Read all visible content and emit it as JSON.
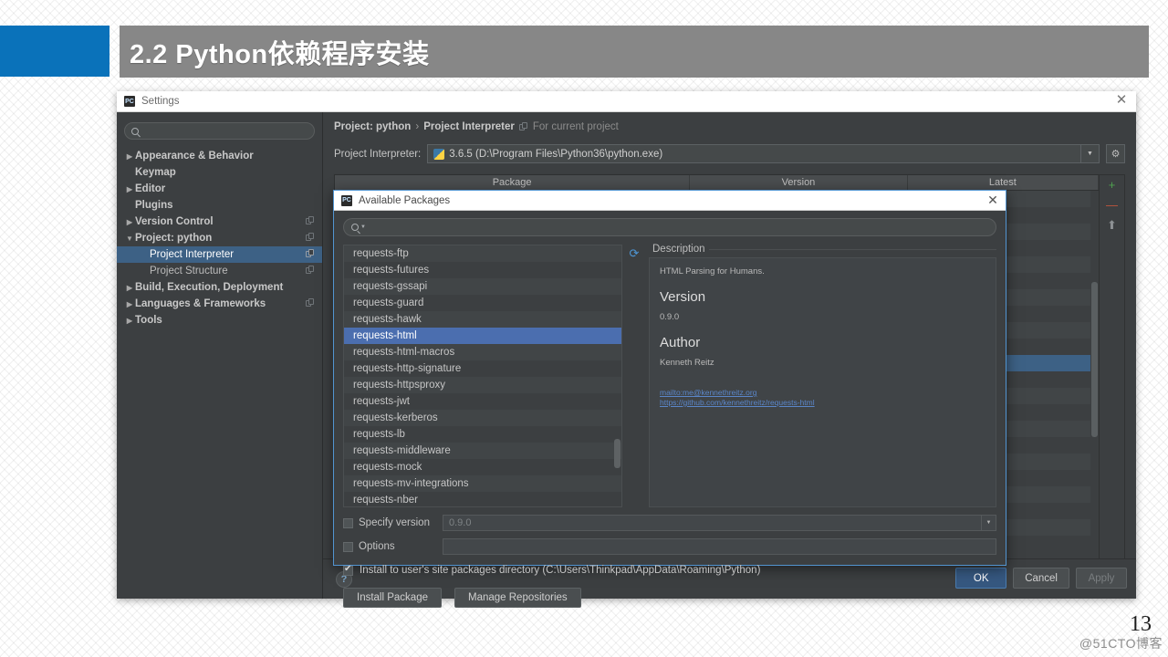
{
  "slide": {
    "title": "2.2 Python依赖程序安装",
    "number": "13",
    "watermark": "@51CTO博客",
    "accent_blue": "#0a72ba",
    "title_bar_gray": "#878787"
  },
  "settings_window": {
    "title": "Settings",
    "close_label": "✕",
    "search_placeholder": "",
    "tree": [
      {
        "label": "Appearance & Behavior",
        "arrow": "▶",
        "indent": 0,
        "bold": true,
        "badge": false,
        "selected": false
      },
      {
        "label": "Keymap",
        "arrow": "",
        "indent": 1,
        "bold": true,
        "badge": false,
        "selected": false
      },
      {
        "label": "Editor",
        "arrow": "▶",
        "indent": 0,
        "bold": true,
        "badge": false,
        "selected": false
      },
      {
        "label": "Plugins",
        "arrow": "",
        "indent": 1,
        "bold": true,
        "badge": false,
        "selected": false
      },
      {
        "label": "Version Control",
        "arrow": "▶",
        "indent": 0,
        "bold": true,
        "badge": true,
        "selected": false
      },
      {
        "label": "Project: python",
        "arrow": "▼",
        "indent": 0,
        "bold": true,
        "badge": true,
        "selected": false
      },
      {
        "label": "Project Interpreter",
        "arrow": "",
        "indent": 2,
        "bold": false,
        "badge": true,
        "selected": true
      },
      {
        "label": "Project Structure",
        "arrow": "",
        "indent": 2,
        "bold": false,
        "badge": true,
        "selected": false
      },
      {
        "label": "Build, Execution, Deployment",
        "arrow": "▶",
        "indent": 0,
        "bold": true,
        "badge": false,
        "selected": false
      },
      {
        "label": "Languages & Frameworks",
        "arrow": "▶",
        "indent": 0,
        "bold": true,
        "badge": true,
        "selected": false
      },
      {
        "label": "Tools",
        "arrow": "▶",
        "indent": 0,
        "bold": true,
        "badge": false,
        "selected": false
      }
    ],
    "breadcrumb": {
      "root": "Project: python",
      "separator": "›",
      "leaf": "Project Interpreter",
      "scope": "For current project"
    },
    "interpreter": {
      "label": "Project Interpreter:",
      "value": "3.6.5 (D:\\Program Files\\Python36\\python.exe)",
      "caret": "▼",
      "gear": "⚙"
    },
    "package_table": {
      "columns": [
        "Package",
        "Version",
        "Latest"
      ],
      "side_actions": [
        {
          "name": "add",
          "glyph": "+",
          "color": "#4fa14f"
        },
        {
          "name": "remove",
          "glyph": "—",
          "color": "#c0553d"
        },
        {
          "name": "upgrade",
          "glyph": "⬆",
          "color": "#8d9194"
        }
      ],
      "selected_row_index": 10,
      "row_count": 22
    },
    "help_label": "?",
    "buttons": {
      "ok": "OK",
      "cancel": "Cancel",
      "apply": "Apply"
    }
  },
  "available_packages_dialog": {
    "title": "Available Packages",
    "close_label": "✕",
    "search_value": "",
    "search_icon": "search-icon",
    "refresh_icon": "refresh-icon",
    "packages": [
      "requests-ftp",
      "requests-futures",
      "requests-gssapi",
      "requests-guard",
      "requests-hawk",
      "requests-html",
      "requests-html-macros",
      "requests-http-signature",
      "requests-httpsproxy",
      "requests-jwt",
      "requests-kerberos",
      "requests-lb",
      "requests-middleware",
      "requests-mock",
      "requests-mv-integrations",
      "requests-nber"
    ],
    "selected_package": "requests-html",
    "description": {
      "label": "Description",
      "summary": "HTML Parsing for Humans.",
      "version_heading": "Version",
      "version_value": "0.9.0",
      "author_heading": "Author",
      "author_value": "Kenneth Reitz",
      "links": [
        "mailto:me@kennethreitz.org",
        "https://github.com/kennethreitz/requests-html"
      ]
    },
    "specify_version": {
      "label": "Specify version",
      "checked": false,
      "value": "0.9.0",
      "caret": "▼"
    },
    "options": {
      "label": "Options",
      "checked": false,
      "value": ""
    },
    "install_to_user_site": {
      "label": "Install to user's site packages directory (C:\\Users\\Thinkpad\\AppData\\Roaming\\Python)",
      "checked": true
    },
    "buttons": {
      "install": "Install Package",
      "install_mnemonic": "I",
      "manage": "Manage Repositories",
      "manage_mnemonic": "M"
    }
  }
}
